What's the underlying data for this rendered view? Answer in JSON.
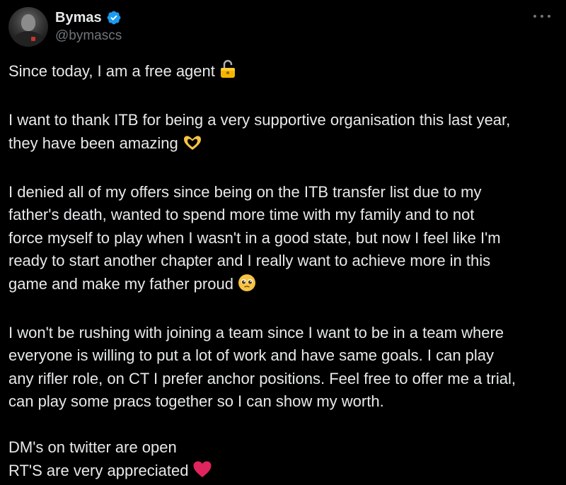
{
  "author": {
    "display_name": "Bymas",
    "handle": "@bymascs",
    "verified": true,
    "avatar_icon": "profile-photo"
  },
  "menu": {
    "icon": "more-horizontal-icon"
  },
  "tweet": {
    "paragraphs": [
      {
        "lines": [
          {
            "text": "Since today, I am a free agent",
            "emoji": "open-lock-icon"
          }
        ]
      },
      {
        "lines": [
          {
            "text": "I want to thank ITB for being a very supportive organisation this last year,"
          },
          {
            "text": "they have been amazing",
            "emoji": "heart-hands-icon"
          }
        ]
      },
      {
        "lines": [
          {
            "text": "I denied all of my offers since being on the ITB transfer list due to my"
          },
          {
            "text": "father's death, wanted to spend more time with my family and to not"
          },
          {
            "text": "force myself to play when I wasn't in a good state, but now I feel like I'm"
          },
          {
            "text": "ready to start another chapter and I really want to achieve more in this"
          },
          {
            "text": "game and make my father proud",
            "emoji": "pleading-face-icon"
          }
        ]
      },
      {
        "lines": [
          {
            "text": "I won't be rushing with joining a team since I want to be in a team where"
          },
          {
            "text": "everyone is willing to put a lot of work and have same goals. I can play"
          },
          {
            "text": "any rifler role, on CT I prefer anchor positions. Feel free to offer me a trial,"
          },
          {
            "text": "can play some pracs together so I can show my worth."
          }
        ]
      },
      {
        "lines": [
          {
            "text": "DM's on twitter are open"
          },
          {
            "text": "RT'S are very appreciated",
            "emoji": "red-heart-icon"
          }
        ]
      }
    ]
  },
  "colors": {
    "background": "#000000",
    "text": "#e7e9ea",
    "secondary_text": "#71767b",
    "verified_blue": "#1d9bf0",
    "heart_red": "#e0245e",
    "lock_gold": "#f4b400"
  }
}
